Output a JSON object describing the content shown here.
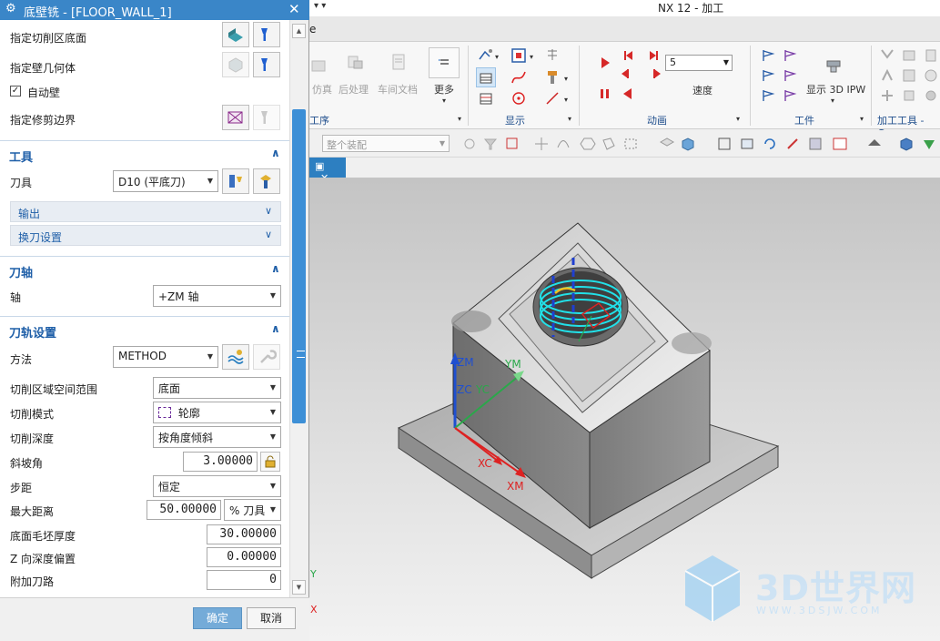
{
  "dialog": {
    "title": "底壁铣 - [FLOOR_WALL_1]",
    "rows": {
      "cut_floor": "指定切削区底面",
      "wall_geom": "指定壁几何体",
      "auto_wall": "自动壁",
      "trim_boundary": "指定修剪边界"
    },
    "tool_section": {
      "title": "工具",
      "tool_label": "刀具",
      "tool_value": "D10 (平底刀)",
      "output": "输出",
      "tool_change": "换刀设置"
    },
    "axis_section": {
      "title": "刀轴",
      "axis_label": "轴",
      "axis_value": "+ZM 轴"
    },
    "path_section": {
      "title": "刀轨设置",
      "method_label": "方法",
      "method_value": "METHOD",
      "cut_region_label": "切削区域空间范围",
      "cut_region_value": "底面",
      "cut_pattern_label": "切削模式",
      "cut_pattern_value": "轮廓",
      "cut_depth_label": "切削深度",
      "cut_depth_value": "按角度倾斜",
      "ramp_label": "斜坡角",
      "ramp_value": "3.00000",
      "stepover_label": "步距",
      "stepover_value": "恒定",
      "max_dist_label": "最大距离",
      "max_dist_value": "50.00000",
      "max_dist_unit": "% 刀具",
      "floor_stock_label": "底面毛坯厚度",
      "floor_stock_value": "30.00000",
      "z_offset_label": "Z 向深度偏置",
      "z_offset_value": "0.00000",
      "extra_passes_label": "附加刀路",
      "extra_passes_value": "0"
    },
    "ok": "确定",
    "cancel": "取消"
  },
  "nx": {
    "title": "NX 12 - 加工",
    "tab_stub": "е",
    "ribbon": {
      "op_group": "工序",
      "display_group": "显示",
      "animation_group": "动画",
      "workpiece_group": "工件",
      "mfg_tools_group": "加工工具 - G...",
      "simulate": "仿真",
      "postprocess": "后处理",
      "shop_doc": "车间文档",
      "more": "更多",
      "speed_label": "速度",
      "speed_value": "5",
      "show_ipw": "显示 3D IPW"
    },
    "assembly_filter": "整个装配",
    "viewport": {
      "labels": [
        "ZM",
        "YM",
        "ZC",
        "YC",
        "XC",
        "XM",
        "Y",
        "X"
      ]
    }
  },
  "watermark": {
    "brand": "3D世界网",
    "url": "WWW.3DSJW.COM"
  },
  "colors": {
    "dialog_title_bg": "#3a86c8",
    "accent_blue": "#1f5fa8",
    "ok_button": "#74abd8",
    "toolpath": "#22e0e8"
  }
}
